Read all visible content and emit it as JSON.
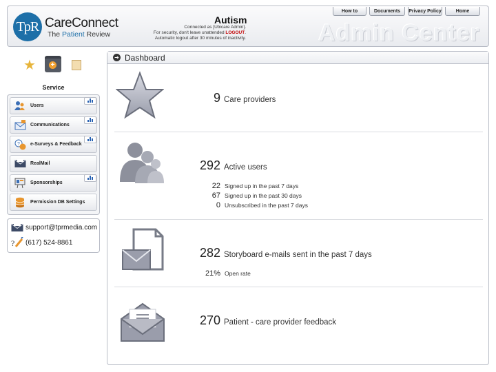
{
  "logo": {
    "mark": "TpR",
    "name": "CareConnect",
    "sub_prefix": "The ",
    "sub_brand": "Patient",
    "sub_suffix": " Review"
  },
  "header": {
    "title": "Autism",
    "connected_as": "Connected as [Ubicare Admin].",
    "security_prefix": "For security, don't leave unattended ",
    "logout": "LOGOUT",
    "security_suffix": ".",
    "auto_logout": "Automatic logout after 30 minutes of inactivity.",
    "admin_center": "Admin Center"
  },
  "topnav": [
    {
      "label": "How to"
    },
    {
      "label": "Documents"
    },
    {
      "label": "Privacy Policy"
    },
    {
      "label": "Home"
    }
  ],
  "sidebar": {
    "section_label": "Service",
    "icons": [
      "star-icon",
      "medical-kit-icon",
      "id-card-icon"
    ],
    "items": [
      {
        "label": "Users",
        "icon": "users-icon",
        "has_stats": true
      },
      {
        "label": "Communications",
        "icon": "communications-icon",
        "has_stats": true
      },
      {
        "label": "e-Surveys & Feedback",
        "icon": "survey-icon",
        "has_stats": true
      },
      {
        "label": "RealMail",
        "icon": "mail-icon",
        "has_stats": false
      },
      {
        "label": "Sponsorships",
        "icon": "sponsorship-icon",
        "has_stats": true
      },
      {
        "label": "Permission DB Settings",
        "icon": "database-icon",
        "has_stats": false
      }
    ],
    "contact": {
      "email": "support@tprmedia.com",
      "phone": "(617) 524-8861"
    }
  },
  "dashboard": {
    "title": "Dashboard",
    "care_providers": {
      "value": "9",
      "label": "Care providers"
    },
    "active_users": {
      "value": "292",
      "label": "Active users",
      "details": [
        {
          "value": "22",
          "label": "Signed up in the past 7 days"
        },
        {
          "value": "67",
          "label": "Signed up in the past 30 days"
        },
        {
          "value": "0",
          "label": "Unsubscribed in the past 7 days"
        }
      ]
    },
    "storyboard": {
      "value": "282",
      "label": "Storyboard e-mails sent in the past 7 days",
      "open_rate": {
        "value": "21%",
        "label": "Open rate"
      }
    },
    "feedback": {
      "value": "270",
      "label": "Patient - care provider feedback"
    }
  },
  "colors": {
    "brand": "#1d6fa8",
    "logout": "#c00000",
    "stats_bar": "#2a63b3",
    "icon_gray": "#7d818c"
  }
}
